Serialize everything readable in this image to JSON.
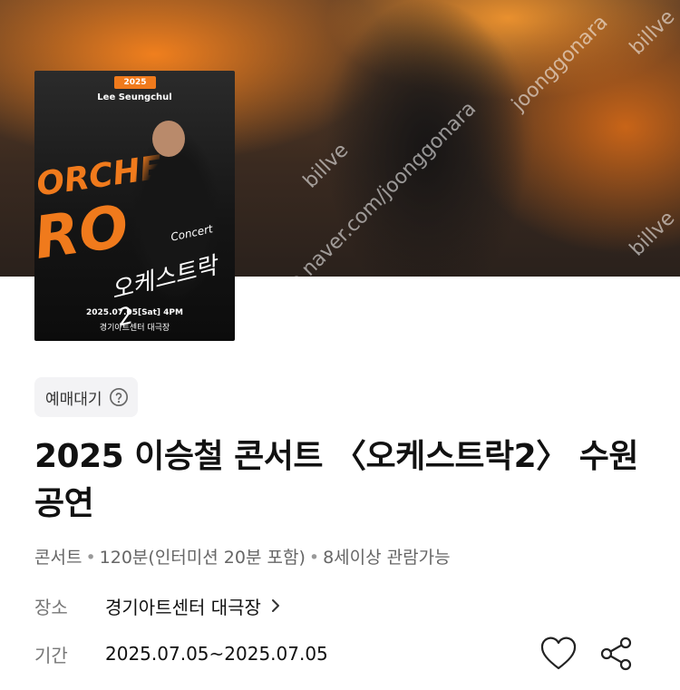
{
  "hero": {
    "watermarks": [
      "billve",
      "joonggonara",
      "billve",
      "cafe.naver.com/joonggonara",
      "billve"
    ]
  },
  "poster": {
    "year": "2025",
    "artist": "Lee Seungchul",
    "big_text_1": "ORCHE",
    "big_text_2": "RO",
    "script_text": "오케스트락2",
    "concert_script": "Concert",
    "date": "2025.07.05[Sat] 4PM",
    "venue": "경기아트센터 대극장"
  },
  "status": {
    "label": "예매대기",
    "icon": "question-circle-icon"
  },
  "title": "2025 이승철 콘서트 〈오케스트락2〉 수원공연",
  "meta": {
    "genre": "콘서트",
    "duration": "120분(인터미션 20분 포함)",
    "age": "8세이상 관람가능",
    "separator": "•"
  },
  "place": {
    "label": "장소",
    "value": "경기아트센터 대극장"
  },
  "period": {
    "label": "기간",
    "value": "2025.07.05~2025.07.05"
  },
  "actions": {
    "like_icon": "heart-icon",
    "share_icon": "share-icon"
  },
  "colors": {
    "accent_orange": "#f07a1c"
  }
}
